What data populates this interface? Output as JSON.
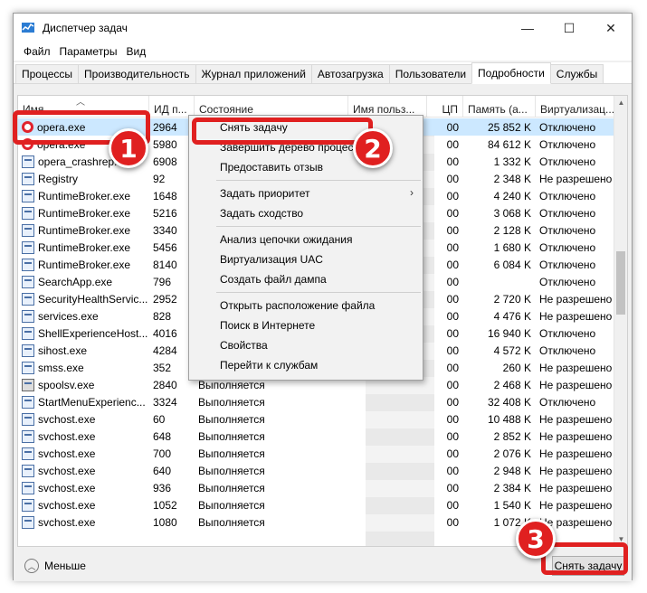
{
  "window": {
    "title": "Диспетчер задач",
    "minimize": "—",
    "maximize": "☐",
    "close": "✕"
  },
  "menu": [
    "Файл",
    "Параметры",
    "Вид"
  ],
  "tabs": [
    "Процессы",
    "Производительность",
    "Журнал приложений",
    "Автозагрузка",
    "Пользователи",
    "Подробности",
    "Службы"
  ],
  "active_tab": "Подробности",
  "columns": [
    "Имя",
    "ИД п...",
    "Состояние",
    "Имя польз...",
    "ЦП",
    "Память (а...",
    "Виртуализац..."
  ],
  "rows": [
    {
      "icon": "opera-icon",
      "name": "opera.exe",
      "pid": "2964",
      "state": "",
      "cpu": "00",
      "mem": "25 852 K",
      "virt": "Отключено",
      "selected": true
    },
    {
      "icon": "opera-icon",
      "name": "opera.exe",
      "pid": "5980",
      "state": "",
      "cpu": "00",
      "mem": "84 612 K",
      "virt": "Отключено"
    },
    {
      "icon": "app-icon",
      "name": "opera_crashrep...",
      "pid": "6908",
      "state": "",
      "cpu": "00",
      "mem": "1 332 K",
      "virt": "Отключено"
    },
    {
      "icon": "app-icon",
      "name": "Registry",
      "pid": "92",
      "state": "",
      "cpu": "00",
      "mem": "2 348 K",
      "virt": "Не разрешено"
    },
    {
      "icon": "app-icon",
      "name": "RuntimeBroker.exe",
      "pid": "1648",
      "state": "",
      "cpu": "00",
      "mem": "4 240 K",
      "virt": "Отключено"
    },
    {
      "icon": "app-icon",
      "name": "RuntimeBroker.exe",
      "pid": "5216",
      "state": "",
      "cpu": "00",
      "mem": "3 068 K",
      "virt": "Отключено"
    },
    {
      "icon": "app-icon",
      "name": "RuntimeBroker.exe",
      "pid": "3340",
      "state": "",
      "cpu": "00",
      "mem": "2 128 K",
      "virt": "Отключено"
    },
    {
      "icon": "app-icon",
      "name": "RuntimeBroker.exe",
      "pid": "5456",
      "state": "",
      "cpu": "00",
      "mem": "1 680 K",
      "virt": "Отключено"
    },
    {
      "icon": "app-icon",
      "name": "RuntimeBroker.exe",
      "pid": "8140",
      "state": "",
      "cpu": "00",
      "mem": "6 084 K",
      "virt": "Отключено"
    },
    {
      "icon": "app-icon",
      "name": "SearchApp.exe",
      "pid": "796",
      "state": "",
      "cpu": "00",
      "mem": "",
      "virt": "Отключено"
    },
    {
      "icon": "app-icon",
      "name": "SecurityHealthServic...",
      "pid": "2952",
      "state": "",
      "cpu": "00",
      "mem": "2 720 K",
      "virt": "Не разрешено"
    },
    {
      "icon": "app-icon",
      "name": "services.exe",
      "pid": "828",
      "state": "",
      "cpu": "00",
      "mem": "4 476 K",
      "virt": "Не разрешено"
    },
    {
      "icon": "app-icon",
      "name": "ShellExperienceHost...",
      "pid": "4016",
      "state": "",
      "cpu": "00",
      "mem": "16 940 K",
      "virt": "Отключено"
    },
    {
      "icon": "app-icon",
      "name": "sihost.exe",
      "pid": "4284",
      "state": "",
      "cpu": "00",
      "mem": "4 572 K",
      "virt": "Отключено"
    },
    {
      "icon": "app-icon",
      "name": "smss.exe",
      "pid": "352",
      "state": "",
      "cpu": "00",
      "mem": "260 K",
      "virt": "Не разрешено"
    },
    {
      "icon": "printer-icon",
      "name": "spoolsv.exe",
      "pid": "2840",
      "state": "Выполняется",
      "cpu": "00",
      "mem": "2 468 K",
      "virt": "Не разрешено"
    },
    {
      "icon": "app-icon",
      "name": "StartMenuExperienc...",
      "pid": "3324",
      "state": "Выполняется",
      "cpu": "00",
      "mem": "32 408 K",
      "virt": "Отключено"
    },
    {
      "icon": "app-icon",
      "name": "svchost.exe",
      "pid": "60",
      "state": "Выполняется",
      "cpu": "00",
      "mem": "10 488 K",
      "virt": "Не разрешено"
    },
    {
      "icon": "app-icon",
      "name": "svchost.exe",
      "pid": "648",
      "state": "Выполняется",
      "cpu": "00",
      "mem": "2 852 K",
      "virt": "Не разрешено"
    },
    {
      "icon": "app-icon",
      "name": "svchost.exe",
      "pid": "700",
      "state": "Выполняется",
      "cpu": "00",
      "mem": "2 076 K",
      "virt": "Не разрешено"
    },
    {
      "icon": "app-icon",
      "name": "svchost.exe",
      "pid": "640",
      "state": "Выполняется",
      "cpu": "00",
      "mem": "2 948 K",
      "virt": "Не разрешено"
    },
    {
      "icon": "app-icon",
      "name": "svchost.exe",
      "pid": "936",
      "state": "Выполняется",
      "cpu": "00",
      "mem": "2 384 K",
      "virt": "Не разрешено"
    },
    {
      "icon": "app-icon",
      "name": "svchost.exe",
      "pid": "1052",
      "state": "Выполняется",
      "cpu": "00",
      "mem": "1 540 K",
      "virt": "Не разрешено"
    },
    {
      "icon": "app-icon",
      "name": "svchost.exe",
      "pid": "1080",
      "state": "Выполняется",
      "cpu": "00",
      "mem": "1 072 K",
      "virt": "Не разрешено"
    }
  ],
  "context_menu": [
    {
      "label": "Снять задачу"
    },
    {
      "label": "Завершить дерево процессов"
    },
    {
      "label": "Предоставить отзыв"
    },
    {
      "sep": true
    },
    {
      "label": "Задать приоритет",
      "sub": "›"
    },
    {
      "label": "Задать сходство"
    },
    {
      "sep": true
    },
    {
      "label": "Анализ цепочки ожидания"
    },
    {
      "label": "Виртуализация UAC"
    },
    {
      "label": "Создать файл дампа"
    },
    {
      "sep": true
    },
    {
      "label": "Открыть расположение файла"
    },
    {
      "label": "Поиск в Интернете"
    },
    {
      "label": "Свойства"
    },
    {
      "label": "Перейти к службам"
    }
  ],
  "footer": {
    "less_label": "Меньше",
    "end_task_label": "Снять задачу"
  },
  "annotations": [
    "1",
    "2",
    "3"
  ],
  "colors": {
    "highlight": "#e02020",
    "selected_row": "#cce8ff",
    "opera_red": "#e0232e"
  }
}
